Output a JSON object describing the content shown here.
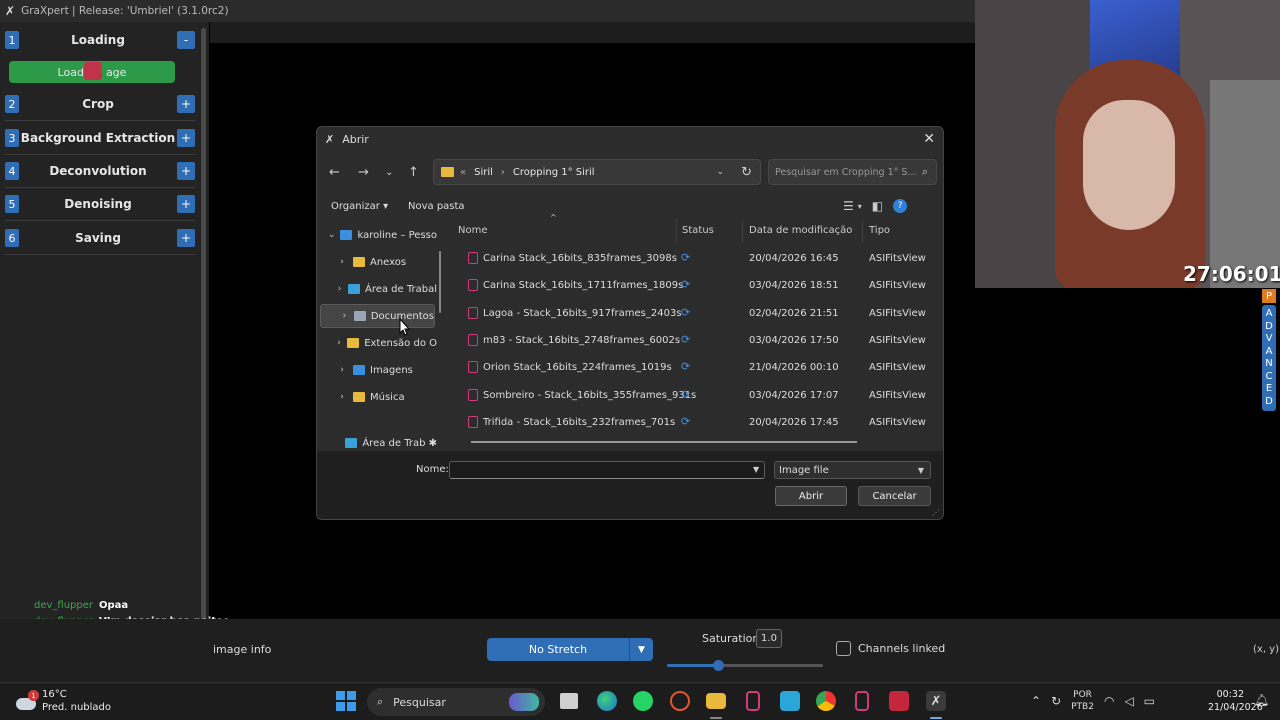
{
  "window": {
    "title": "GraXpert | Release: 'Umbriel' (3.1.0rc2)"
  },
  "sidebar": {
    "steps": [
      {
        "num": "1",
        "label": "Loading",
        "toggle": "-"
      },
      {
        "num": "2",
        "label": "Crop",
        "toggle": "+"
      },
      {
        "num": "3",
        "label": "Background Extraction",
        "toggle": "+"
      },
      {
        "num": "4",
        "label": "Deconvolution",
        "toggle": "+"
      },
      {
        "num": "5",
        "label": "Denoising",
        "toggle": "+"
      },
      {
        "num": "6",
        "label": "Saving",
        "toggle": "+"
      }
    ],
    "load_button_left": "Load",
    "load_button_right": "age"
  },
  "chat": [
    {
      "user": "dev_flupper",
      "message": "Opaa"
    },
    {
      "user": "dev_flupper",
      "message": "VIm desejar boa noitee"
    }
  ],
  "bottombar": {
    "image_info": "image info",
    "stretch_value": "No Stretch",
    "saturation_label": "Saturation",
    "saturation_value": "1.0",
    "saturation_level": 0.33,
    "channels_linked": "Channels linked",
    "coords": "(x, y)"
  },
  "webcam": {
    "timer": "27:06:01"
  },
  "advanced": {
    "p": "P",
    "letters": [
      "A",
      "D",
      "V",
      "A",
      "N",
      "C",
      "E",
      "D"
    ]
  },
  "dialog": {
    "title": "Abrir",
    "path": [
      "Siril",
      "Cropping 1° Siril"
    ],
    "path_prefix": "«",
    "search_placeholder": "Pesquisar em Cropping 1° S...",
    "organize": "Organizar ▾",
    "new_folder": "Nova pasta",
    "tree": [
      {
        "label": "karoline – Pesso",
        "icon": "onedrive-icon",
        "color": "#3a8fe0",
        "expanded": true
      },
      {
        "label": "Anexos",
        "icon": "folder-icon",
        "color": "#e8b93b"
      },
      {
        "label": "Área de Trabal",
        "icon": "desktop-icon",
        "color": "#3aa0d8"
      },
      {
        "label": "Documentos",
        "icon": "document-icon",
        "color": "#9aa5b5",
        "selected": true
      },
      {
        "label": "Extensão do O",
        "icon": "folder-icon",
        "color": "#e8b93b"
      },
      {
        "label": "Imagens",
        "icon": "pictures-icon",
        "color": "#3a8fe0"
      },
      {
        "label": "Música",
        "icon": "folder-icon",
        "color": "#e8b93b"
      },
      {
        "label": "Área de Trab ✱",
        "icon": "desktop-icon",
        "color": "#3aa0d8"
      }
    ],
    "columns": {
      "name": "Nome",
      "status": "Status",
      "date": "Data de modificação",
      "type": "Tipo"
    },
    "files": [
      {
        "name": "Carina Stack_16bits_835frames_3098s",
        "date": "20/04/2026 16:45",
        "type": "ASIFitsView"
      },
      {
        "name": "Carina Stack_16bits_1711frames_1809s",
        "date": "03/04/2026 18:51",
        "type": "ASIFitsView"
      },
      {
        "name": "Lagoa - Stack_16bits_917frames_2403s",
        "date": "02/04/2026 21:51",
        "type": "ASIFitsView"
      },
      {
        "name": "m83 - Stack_16bits_2748frames_6002s",
        "date": "03/04/2026 17:50",
        "type": "ASIFitsView"
      },
      {
        "name": "Orion Stack_16bits_224frames_1019s",
        "date": "21/04/2026 00:10",
        "type": "ASIFitsView"
      },
      {
        "name": "Sombreiro - Stack_16bits_355frames_931s",
        "date": "03/04/2026 17:07",
        "type": "ASIFitsView"
      },
      {
        "name": "Trifida - Stack_16bits_232frames_701s",
        "date": "20/04/2026 17:45",
        "type": "ASIFitsView"
      }
    ],
    "name_label": "Nome:",
    "name_value": "",
    "filetype": "Image file",
    "open_button": "Abrir",
    "cancel_button": "Cancelar"
  },
  "taskbar": {
    "temperature": "16°C",
    "weather": "Pred. nublado",
    "weather_badge": "1",
    "search": "Pesquisar",
    "lang_line1": "POR",
    "lang_line2": "PTB2",
    "time": "00:32",
    "date": "21/04/2026"
  }
}
